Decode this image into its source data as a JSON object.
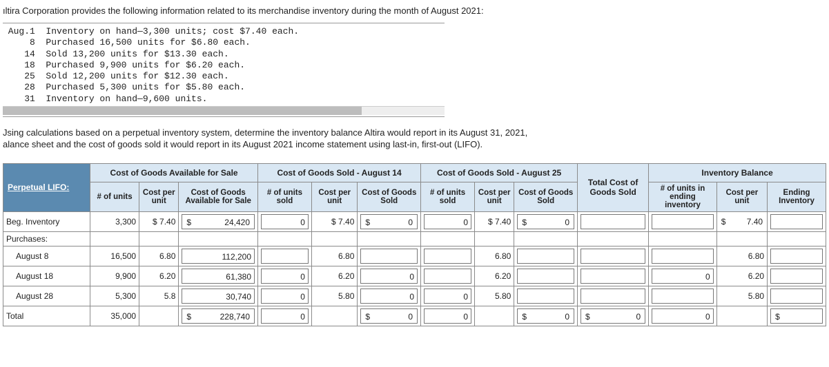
{
  "intro": "ıltira Corporation provides the following information related to its merchandise inventory during the month of August 2021:",
  "transactions_block": " Aug.1  Inventory on hand—3,300 units; cost $7.40 each.\n     8  Purchased 16,500 units for $6.80 each.\n    14  Sold 13,200 units for $13.30 each.\n    18  Purchased 9,900 units for $6.20 each.\n    25  Sold 12,200 units for $12.30 each.\n    28  Purchased 5,300 units for $5.80 each.\n    31  Inventory on hand—9,600 units.",
  "instructions_line1": "Jsing calculations based on a perpetual inventory system, determine the inventory balance Altira would report in its August 31, 2021,",
  "instructions_line2": "alance sheet and the cost of goods sold it would report in its August 2021 income statement using last-in, first-out (LIFO).",
  "headers": {
    "corner": "Perpetual LIFO:",
    "group_avail": "Cost of Goods Available for Sale",
    "group_cogs14": "Cost of Goods Sold - August 14",
    "group_cogs25": "Cost of Goods Sold - August 25",
    "group_total_cogs": "Total Cost of Goods Sold",
    "group_inv": "Inventory Balance",
    "avail_units": "# of units",
    "avail_cost": "Cost per unit",
    "avail_total": "Cost of Goods Available for Sale",
    "cogs14_units": "# of units sold",
    "cogs14_cost": "Cost per unit",
    "cogs14_total": "Cost of Goods Sold",
    "cogs25_units": "# of units sold",
    "cogs25_cost": "Cost per unit",
    "cogs25_total": "Cost of Goods Sold",
    "inv_units": "# of units in ending inventory",
    "inv_cost": "Cost per unit",
    "inv_total": "Ending Inventory"
  },
  "rows": {
    "beg": {
      "label": "Beg. Inventory",
      "units": "3,300",
      "cpu": "$ 7.40",
      "avail_total": "24,420",
      "c14_units": "0",
      "c14_cpu": "$ 7.40",
      "c14_total": "0",
      "c25_units": "0",
      "c25_cpu": "$ 7.40",
      "c25_total": "0",
      "inv_units": "",
      "inv_cpu": "7.40",
      "inv_total": ""
    },
    "purch_label": "Purchases:",
    "aug8": {
      "label": "August 8",
      "units": "16,500",
      "cpu": "6.80",
      "avail_total": "112,200",
      "c14_units": "",
      "c14_cpu": "6.80",
      "c14_total": "",
      "c25_units": "",
      "c25_cpu": "6.80",
      "c25_total": "",
      "inv_units": "",
      "inv_cpu": "6.80",
      "inv_total": ""
    },
    "aug18": {
      "label": "August 18",
      "units": "9,900",
      "cpu": "6.20",
      "avail_total": "61,380",
      "c14_units": "0",
      "c14_cpu": "6.20",
      "c14_total": "0",
      "c25_units": "",
      "c25_cpu": "6.20",
      "c25_total": "",
      "inv_units": "0",
      "inv_cpu": "6.20",
      "inv_total": ""
    },
    "aug28": {
      "label": "August 28",
      "units": "5,300",
      "cpu": "5.8",
      "avail_total": "30,740",
      "c14_units": "0",
      "c14_cpu": "5.80",
      "c14_total": "0",
      "c25_units": "0",
      "c25_cpu": "5.80",
      "c25_total": "",
      "inv_units": "",
      "inv_cpu": "5.80",
      "inv_total": ""
    },
    "total": {
      "label": "Total",
      "units": "35,000",
      "avail_total": "228,740",
      "c14_units": "0",
      "c14_total": "0",
      "c25_units": "0",
      "c25_total": "0",
      "tcogs": "0",
      "inv_units": "0",
      "inv_total": ""
    }
  },
  "sym": "$"
}
